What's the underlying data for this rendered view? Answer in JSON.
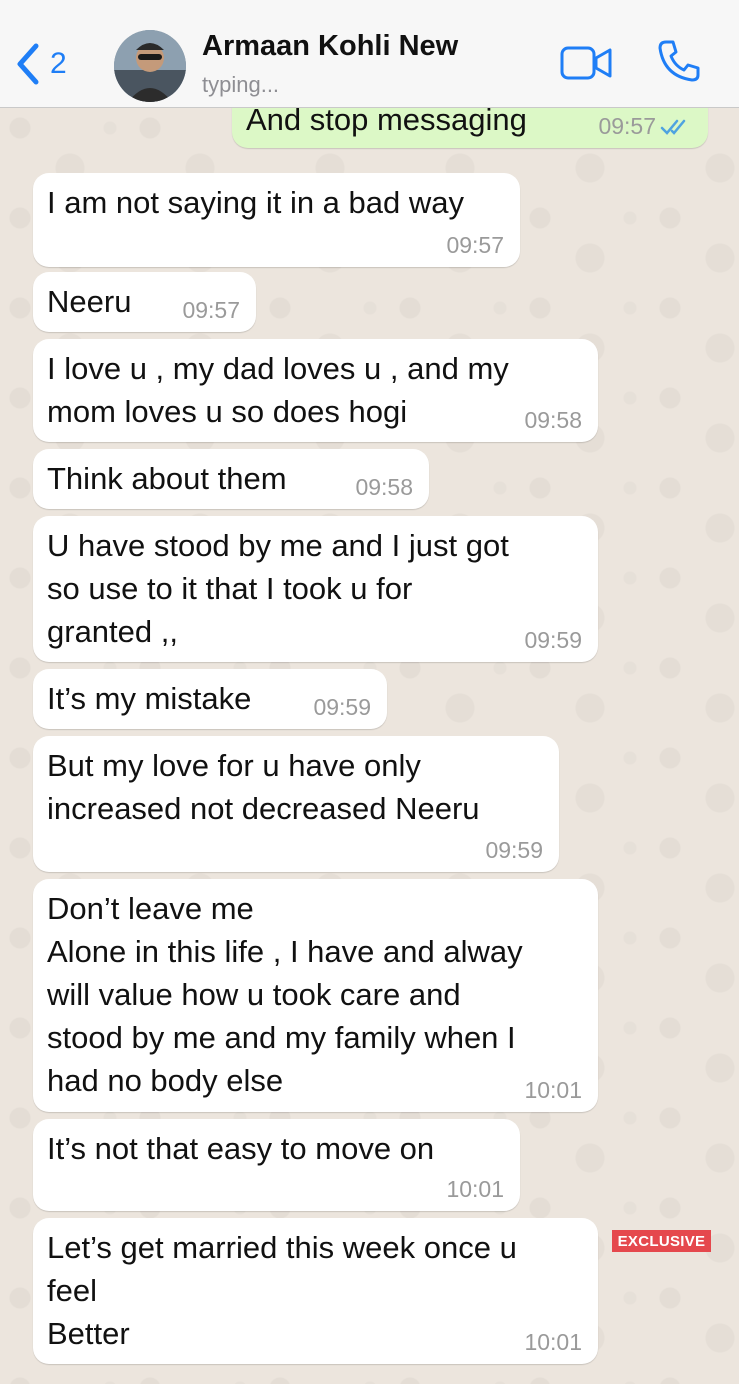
{
  "header": {
    "back_count": "2",
    "contact_name": "Armaan Kohli New",
    "status": "typing..."
  },
  "messages": [
    {
      "direction": "out",
      "text": "And stop messaging",
      "time": "09:57",
      "ticks": "read"
    },
    {
      "direction": "in",
      "text": "I am not saying it in a bad way",
      "time": "09:57"
    },
    {
      "direction": "in",
      "text": "Neeru",
      "time": "09:57"
    },
    {
      "direction": "in",
      "text": "I love u , my dad loves u , and my\nmom loves u so does hogi",
      "time": "09:58"
    },
    {
      "direction": "in",
      "text": "Think about them",
      "time": "09:58"
    },
    {
      "direction": "in",
      "text": "U have stood by me and I just got\nso use to it that I took u for\ngranted ,,",
      "time": "09:59"
    },
    {
      "direction": "in",
      "text": "It’s my mistake",
      "time": "09:59"
    },
    {
      "direction": "in",
      "text": "But my love for u have only\nincreased not decreased Neeru",
      "time": "09:59"
    },
    {
      "direction": "in",
      "text": "Don’t leave me\nAlone in this life , I have and alway\nwill value how u took care and\nstood by me and my family when I\nhad no body else",
      "time": "10:01"
    },
    {
      "direction": "in",
      "text": "It’s not that easy to move on",
      "time": "10:01"
    },
    {
      "direction": "in",
      "text": "Let’s get married this week once u\nfeel\nBetter",
      "time": "10:01"
    }
  ],
  "watermark": "EXCLUSIVE",
  "colors": {
    "accent": "#1f7ef6",
    "outgoing_bubble": "#dcf8c6",
    "incoming_bubble": "#ffffff",
    "read_ticks": "#4fa3e0",
    "watermark_bg": "#e5484d"
  },
  "icons": {
    "back": "chevron-left-icon",
    "video": "video-camera-icon",
    "call": "phone-icon",
    "ticks": "double-check-icon"
  }
}
